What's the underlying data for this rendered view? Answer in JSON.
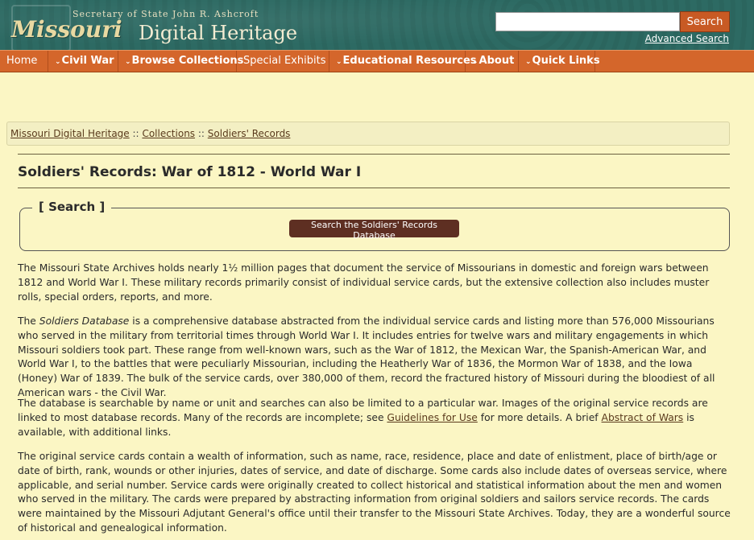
{
  "header": {
    "secretary": "Secretary of State John R. Ashcroft",
    "logo_missouri": "Missouri",
    "logo_digital_heritage": "Digital Heritage",
    "search_value": "",
    "search_button": "Search",
    "advanced_search": "Advanced Search"
  },
  "nav": [
    {
      "label": "Home",
      "dropdown": false
    },
    {
      "label": "Civil War",
      "dropdown": true
    },
    {
      "label": "Browse Collections",
      "dropdown": true
    },
    {
      "label": "Special Exhibits",
      "dropdown": false
    },
    {
      "label": "Educational Resources",
      "dropdown": true
    },
    {
      "label": "About",
      "dropdown": true
    },
    {
      "label": "Quick Links",
      "dropdown": true
    }
  ],
  "breadcrumb": {
    "items": [
      "Missouri Digital Heritage",
      "Collections",
      "Soldiers' Records"
    ],
    "separator": "::"
  },
  "page_title": "Soldiers' Records: War of 1812 - World War I",
  "search_section": {
    "legend": "[ Search ]",
    "button": "Search the Soldiers' Records Database"
  },
  "paragraphs": {
    "p1": "The Missouri State Archives holds nearly 1½ million pages that document the service of Missourians in domestic and foreign wars between 1812 and World War I. These military records primarily consist of individual service cards, but the extensive collection also includes muster rolls, special orders, reports, and more.",
    "p2_prefix": "The ",
    "p2_italic": "Soldiers Database",
    "p2_rest": " is a comprehensive database abstracted from the individual service cards and listing more than 576,000 Missourians who served in the military from territorial times through World War I. It includes entries for twelve wars and military engagements in which Missouri soldiers took part. These range from well-known wars, such as the War of 1812, the Mexican War, the Spanish-American War, and World War I, to the battles that were peculiarly Missourian, including the Heatherly War of 1836, the Mormon War of 1838, and the Iowa (Honey) War of 1839. The bulk of the service cards, over 380,000 of them, record the fractured history of Missouri during the bloodiest of all American wars - the Civil War.",
    "p3_a": "The database is searchable by name or unit and searches can also be limited to a particular war. Images of the original service records are linked to most database records. Many of the records are incomplete; see ",
    "p3_link1": "Guidelines for Use",
    "p3_b": " for more details. A brief ",
    "p3_link2": "Abstract of Wars",
    "p3_c": " is available, with additional links.",
    "p4": "The original service cards contain a wealth of information, such as name, race, residence, place and date of enlistment, place of birth/age or date of birth, rank, wounds or other injuries, dates of service, and date of discharge. Some cards also include dates of overseas service, where applicable, and serial number. Service cards were originally created to collect historical and statistical information about the men and women who served in the military. The cards were prepared by abstracting information from original soldiers and sailors service records. The cards were maintained by the Missouri Adjutant General's office until their transfer to the Missouri State Archives. Today, they are a wonderful source of historical and genealogical information."
  },
  "colors": {
    "header_bg": "#2d6a63",
    "nav_bg": "#d4662b",
    "page_bg": "#fbf6c4",
    "button_bg": "#5e2f22"
  }
}
